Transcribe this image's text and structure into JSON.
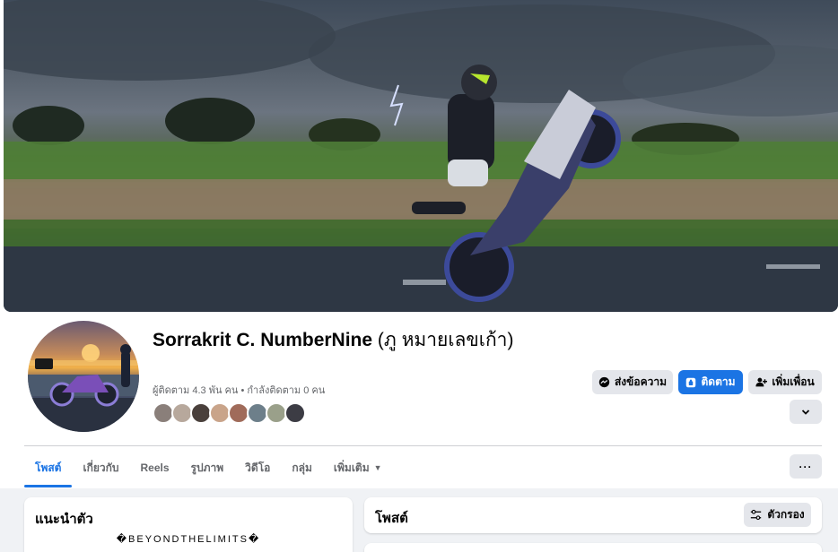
{
  "profile": {
    "name": "Sorrakrit C. NumberNine",
    "alternate_name": "(ภู หมายเลขเก้า)",
    "follow_stats": "ผู้ติดตาม 4.3 พัน คน • กำลังติดตาม 0 คน",
    "friend_avatar_colors": [
      "#8a7f7a",
      "#b7a89c",
      "#4a403c",
      "#c9a48a",
      "#a06b5a",
      "#6d7f8a",
      "#9aa08a",
      "#3c3c44"
    ]
  },
  "actions": {
    "message_label": "ส่งข้อความ",
    "follow_label": "ติดตาม",
    "add_friend_label": "เพิ่มเพื่อน"
  },
  "tabs": [
    {
      "label": "โพสต์"
    },
    {
      "label": "เกี่ยวกับ"
    },
    {
      "label": "Reels"
    },
    {
      "label": "รูปภาพ"
    },
    {
      "label": "วิดีโอ"
    },
    {
      "label": "กลุ่ม"
    },
    {
      "label": "เพิ่มเติม"
    }
  ],
  "more_button_label": "···",
  "intro": {
    "title": "แนะนำตัว",
    "bio": "�BEYONDTHELIMITS�"
  },
  "posts": {
    "title": "โพสต์",
    "filter_label": "ตัวกรอง"
  },
  "colors": {
    "accent": "#1b74e4",
    "button_gray": "#e4e6eb",
    "page_bg": "#f0f2f5"
  }
}
